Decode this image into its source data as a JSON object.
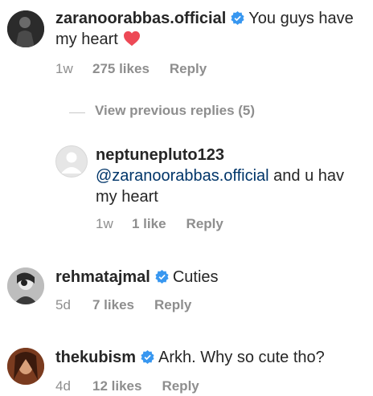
{
  "comments": [
    {
      "username": "zaranoorabbas.official",
      "verified": true,
      "text_line1": "You guys have",
      "text_line2": "my heart",
      "time": "1w",
      "likes": "275 likes",
      "reply": "Reply",
      "icon": "heart-emoji"
    },
    {
      "username": "neptunepluto123",
      "mention": "@zaranoorabbas.official",
      "text_rest": " and u hav",
      "text_line2": "my heart",
      "time": "1w",
      "likes": "1 like",
      "reply": "Reply"
    },
    {
      "username": "rehmatajmal",
      "verified": true,
      "text": "Cuties",
      "time": "5d",
      "likes": "7 likes",
      "reply": "Reply"
    },
    {
      "username": "thekubism",
      "verified": true,
      "text": "Arkh. Why so cute tho?",
      "time": "4d",
      "likes": "12 likes",
      "reply": "Reply"
    }
  ],
  "view_previous_replies": "View previous replies (5)",
  "colors": {
    "verified": "#3897f0",
    "mention": "#003569",
    "meta": "#8e8e8e",
    "heart": "#ed4956"
  }
}
